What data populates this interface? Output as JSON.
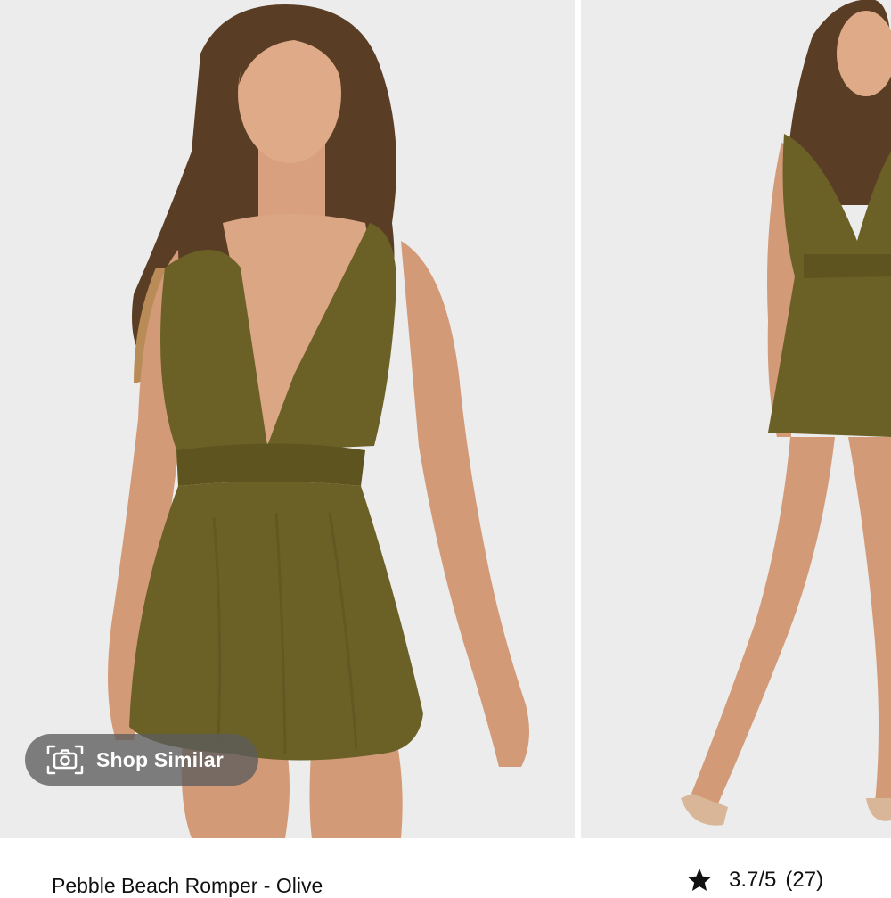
{
  "gallery": {
    "images": [
      {
        "name": "main-product-photo"
      },
      {
        "name": "second-product-photo"
      }
    ],
    "shop_similar": {
      "label": "Shop Similar",
      "icon": "camera-icon"
    }
  },
  "product": {
    "name": "Pebble Beach Romper - Olive",
    "rating": {
      "icon": "star-icon",
      "score": "3.7/5",
      "count": "(27)"
    }
  },
  "colors": {
    "background": "#ececec",
    "olive": "#6b6127",
    "skin": "#d9a080",
    "hair": "#5a3d25",
    "button_bg": "#5c5c5c"
  }
}
